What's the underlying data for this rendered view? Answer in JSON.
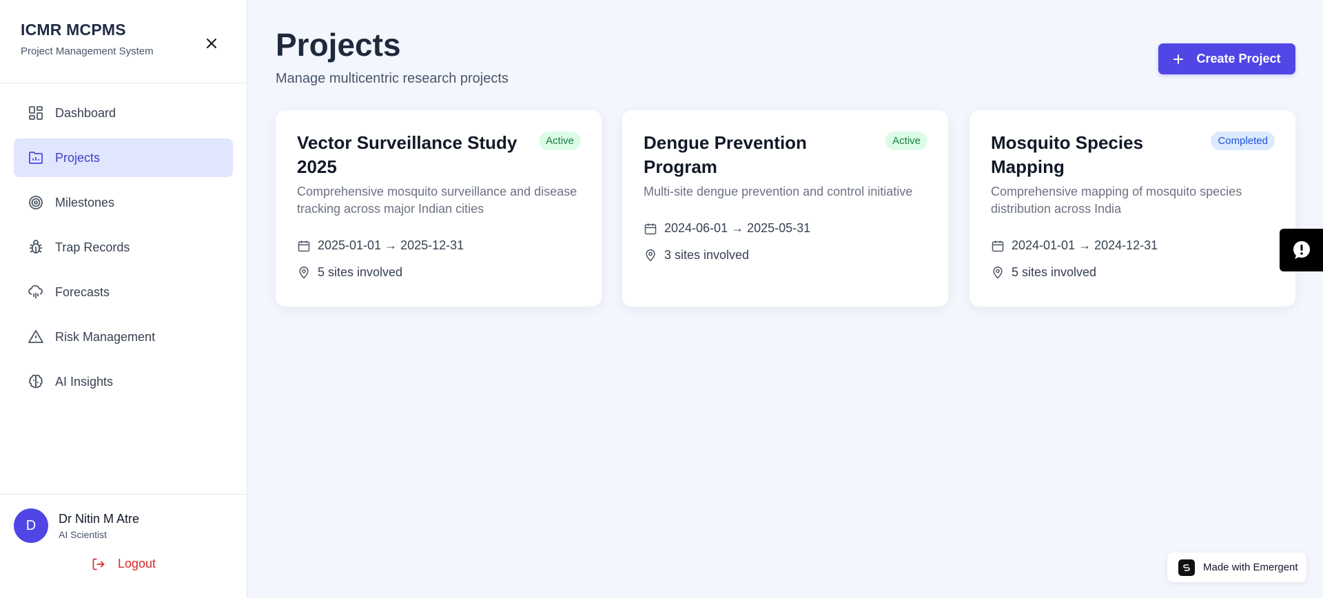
{
  "brand": {
    "title": "ICMR MCPMS",
    "subtitle": "Project Management System"
  },
  "nav": [
    {
      "label": "Dashboard",
      "icon": "dashboard-icon",
      "active": false
    },
    {
      "label": "Projects",
      "icon": "folder-chart-icon",
      "active": true
    },
    {
      "label": "Milestones",
      "icon": "target-icon",
      "active": false
    },
    {
      "label": "Trap Records",
      "icon": "bug-icon",
      "active": false
    },
    {
      "label": "Forecasts",
      "icon": "cloud-rain-icon",
      "active": false
    },
    {
      "label": "Risk Management",
      "icon": "alert-triangle-icon",
      "active": false
    },
    {
      "label": "AI Insights",
      "icon": "brain-icon",
      "active": false
    }
  ],
  "user": {
    "initial": "D",
    "name": "Dr Nitin M Atre",
    "role": "AI Scientist",
    "logout_label": "Logout"
  },
  "header": {
    "title": "Projects",
    "subtitle": "Manage multicentric research projects",
    "create_label": "Create Project"
  },
  "projects": [
    {
      "title": "Vector Surveillance Study 2025",
      "status": "Active",
      "description": "Comprehensive mosquito surveillance and disease tracking across major Indian cities",
      "dates": "2025-01-01 → 2025-12-31",
      "sites": "5 sites involved"
    },
    {
      "title": "Dengue Prevention Program",
      "status": "Active",
      "description": "Multi-site dengue prevention and control initiative",
      "dates": "2024-06-01 → 2025-05-31",
      "sites": "3 sites involved"
    },
    {
      "title": "Mosquito Species Mapping",
      "status": "Completed",
      "description": "Comprehensive mapping of mosquito species distribution across India",
      "dates": "2024-01-01 → 2024-12-31",
      "sites": "5 sites involved"
    }
  ],
  "badge": {
    "label": "Made with Emergent"
  },
  "colors": {
    "accent": "#4f46e5",
    "active_bg": "#e0e6fd",
    "danger": "#dc2626"
  }
}
